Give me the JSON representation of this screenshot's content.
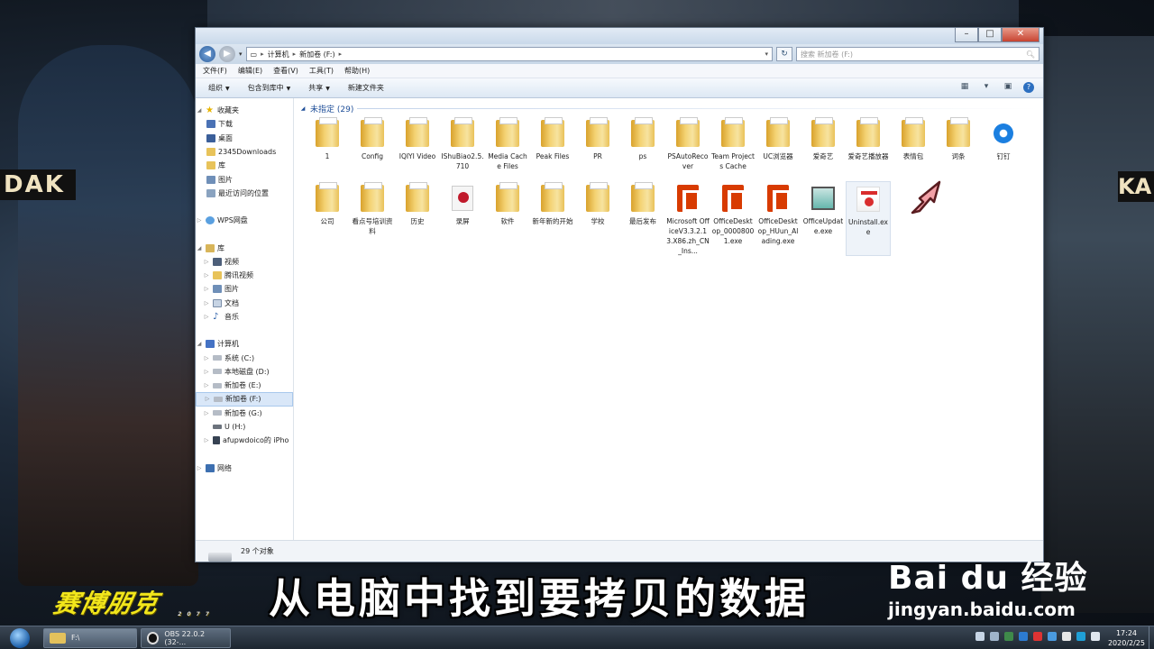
{
  "window": {
    "breadcrumb": [
      "计算机",
      "新加卷 (F:)"
    ],
    "search_placeholder": "搜索 新加卷 (F:)",
    "menu": [
      "文件(F)",
      "编辑(E)",
      "查看(V)",
      "工具(T)",
      "帮助(H)"
    ],
    "toolbar": [
      "组织",
      "包含到库中",
      "共享",
      "新建文件夹"
    ],
    "nav": {
      "favorites_label": "收藏夹",
      "favorites": [
        "下载",
        "桌面",
        "2345Downloads",
        "库",
        "图片",
        "最近访问的位置"
      ],
      "cloud_label": "WPS网盘",
      "libraries_label": "库",
      "libraries": [
        "视频",
        "腾讯视频",
        "图片",
        "文档",
        "音乐"
      ],
      "computer_label": "计算机",
      "drives": [
        "系统 (C:)",
        "本地磁盘 (D:)",
        "新加卷 (E:)",
        "新加卷 (F:)",
        "新加卷 (G:)",
        "U (H:)",
        "afupwdoico的 iPho"
      ],
      "network_label": "网络"
    },
    "group_header": "未指定 (29)",
    "items": [
      {
        "label": "1",
        "type": "folder"
      },
      {
        "label": "Config",
        "type": "folder"
      },
      {
        "label": "IQIYI Video",
        "type": "folder"
      },
      {
        "label": "IShuBiao2.5.710",
        "type": "folder"
      },
      {
        "label": "Media Cache Files",
        "type": "folder"
      },
      {
        "label": "Peak Files",
        "type": "folder"
      },
      {
        "label": "PR",
        "type": "folder"
      },
      {
        "label": "ps",
        "type": "folder"
      },
      {
        "label": "PSAutoRecover",
        "type": "folder"
      },
      {
        "label": "Team Projects Cache",
        "type": "folder"
      },
      {
        "label": "UC浏览器",
        "type": "folder"
      },
      {
        "label": "爱奇艺",
        "type": "folder"
      },
      {
        "label": "爱奇艺播放器",
        "type": "folder"
      },
      {
        "label": "表情包",
        "type": "folder"
      },
      {
        "label": "词条",
        "type": "folder"
      },
      {
        "label": "钉钉",
        "type": "dingtalk"
      },
      {
        "label": "公司",
        "type": "folder"
      },
      {
        "label": "看点号培训资料",
        "type": "folder"
      },
      {
        "label": "历史",
        "type": "folder"
      },
      {
        "label": "录屏",
        "type": "recorder"
      },
      {
        "label": "软件",
        "type": "folder"
      },
      {
        "label": "新年新的开始",
        "type": "folder"
      },
      {
        "label": "学校",
        "type": "folder"
      },
      {
        "label": "最后发布",
        "type": "folder"
      },
      {
        "label": "Microsoft OfficeV3.3.2.13.X86.zh_CN_Ins...",
        "type": "office"
      },
      {
        "label": "OfficeDesktop_00008001.exe",
        "type": "office"
      },
      {
        "label": "OfficeDesktop_HUun_Alading.exe",
        "type": "office"
      },
      {
        "label": "OfficeUpdate.exe",
        "type": "update"
      },
      {
        "label": "Uninstall.exe",
        "type": "uninstall"
      }
    ],
    "status": "29 个对象"
  },
  "overlay": {
    "caption": "从电脑中找到要拷贝的数据",
    "game_logo": "赛博朋克",
    "game_logo_sub": "2077",
    "watermark_main": "Bai  du 经验",
    "watermark_sub": "jingyan.baidu.com",
    "sign_left": "DAK",
    "sign_right": "KA"
  },
  "taskbar": {
    "tasks": [
      "F:\\",
      "OBS 22.0.2 (32-..."
    ],
    "time": "17:24",
    "date": "2020/2/25"
  },
  "colors": {
    "accent": "#1e4e98",
    "caption": "#ffffff",
    "logo": "#f2e61b"
  }
}
